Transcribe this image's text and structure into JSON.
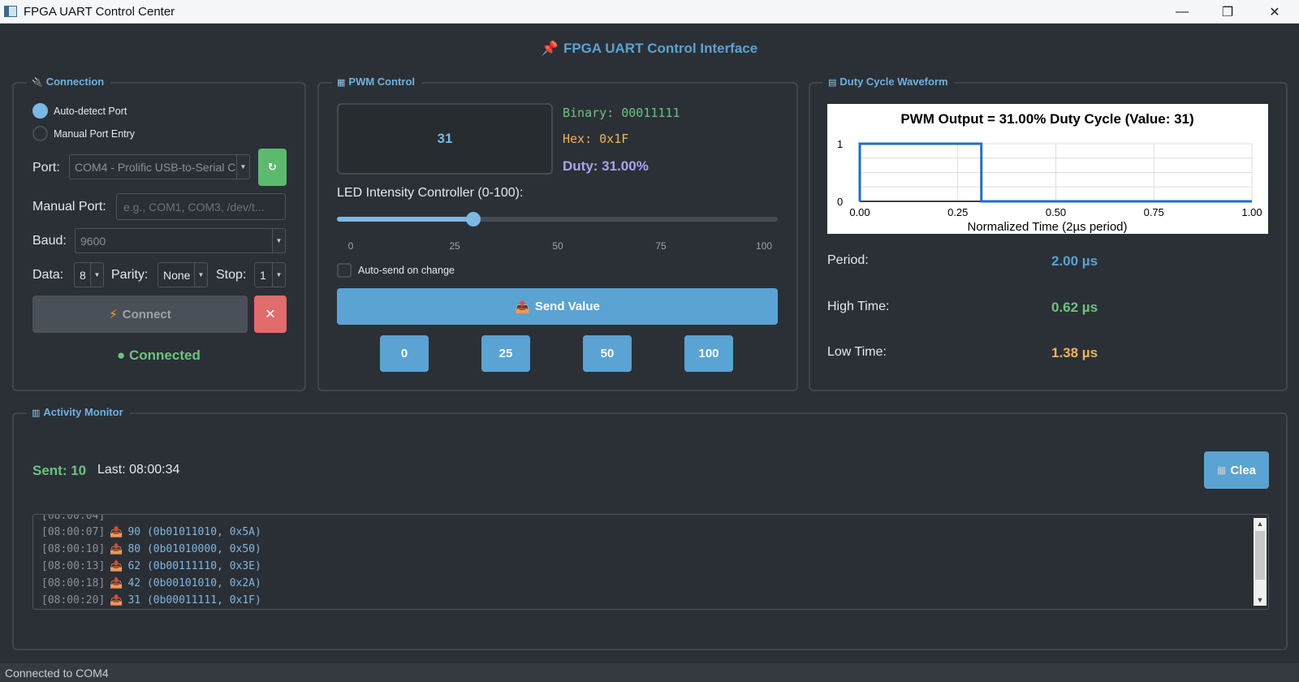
{
  "window": {
    "title": "FPGA UART Control Center",
    "minimize": "—",
    "restore": "❐",
    "close": "✕"
  },
  "header": {
    "icon": "📌",
    "title": "FPGA UART Control Interface"
  },
  "connection": {
    "title": "Connection",
    "auto_detect": "Auto-detect Port",
    "manual_entry": "Manual Port Entry",
    "port_label": "Port:",
    "port_value": "COM4 - Prolific USB-to-Serial C",
    "manual_port_label": "Manual Port:",
    "manual_port_placeholder": "e.g., COM1, COM3, /dev/t...",
    "baud_label": "Baud:",
    "baud_value": "9600",
    "data_label": "Data:",
    "data_value": "8",
    "parity_label": "Parity:",
    "parity_value": "None",
    "stop_label": "Stop:",
    "stop_value": "1",
    "connect_label": "Connect",
    "disconnect_label": "✕",
    "status": "● Connected"
  },
  "pwm": {
    "title": "PWM Control",
    "value": "31",
    "binary": "Binary: 00011111",
    "hex": "Hex: 0x1F",
    "duty": "Duty: 31.00%",
    "slider_label": "LED Intensity Controller (0-100):",
    "slider_value": 31,
    "slider_max": 100,
    "ticks": [
      "0",
      "25",
      "50",
      "75",
      "100"
    ],
    "auto_send": "Auto-send on change",
    "send_label": "Send Value",
    "presets": [
      "0",
      "25",
      "50",
      "100"
    ]
  },
  "waveform": {
    "title": "Duty Cycle Waveform",
    "period_label": "Period:",
    "period_value": "2.00 µs",
    "high_label": "High Time:",
    "high_value": "0.62 µs",
    "low_label": "Low Time:",
    "low_value": "1.38 µs"
  },
  "chart_data": {
    "type": "line",
    "title": "PWM Output = 31.00% Duty Cycle (Value: 31)",
    "xlabel": "Normalized Time (2µs period)",
    "ylabel": "",
    "x": [
      0,
      0,
      0.31,
      0.31,
      1.0
    ],
    "y": [
      0,
      1,
      1,
      0,
      0
    ],
    "xlim": [
      0,
      1.0
    ],
    "ylim": [
      0,
      1
    ],
    "x_ticks": [
      "0.00",
      "0.25",
      "0.50",
      "0.75",
      "1.00"
    ],
    "y_ticks": [
      "0",
      "1"
    ],
    "grid": true,
    "color": "#1f6fc4"
  },
  "activity": {
    "title": "Activity Monitor",
    "sent": "Sent: 10",
    "last": "Last: 08:00:34",
    "clear_label": "Clea",
    "log": [
      {
        "ts": "[08:00:07]",
        "val": "90 (0b01011010, 0x5A)"
      },
      {
        "ts": "[08:00:10]",
        "val": "80 (0b01010000, 0x50)"
      },
      {
        "ts": "[08:00:13]",
        "val": "62 (0b00111110, 0x3E)"
      },
      {
        "ts": "[08:00:18]",
        "val": "42 (0b00101010, 0x2A)"
      },
      {
        "ts": "[08:00:20]",
        "val": "31 (0b00011111, 0x1F)"
      }
    ]
  },
  "status_bar": "Connected to COM4",
  "colors": {
    "accent": "#5aa3d3",
    "success": "#6cc47e",
    "warning": "#f0b35a",
    "danger": "#e06c6c",
    "duty": "#a9a4f0"
  }
}
